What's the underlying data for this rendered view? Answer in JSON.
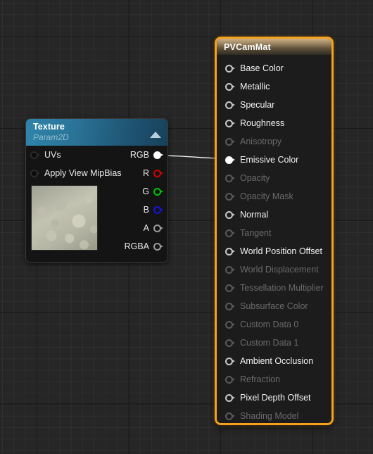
{
  "editor": {
    "name": "material-graph-editor",
    "background_color": "#262626",
    "grid_line_color": "#2f2f2f"
  },
  "texture_node": {
    "title": "Texture",
    "subtitle": "Param2D",
    "collapse_icon": "triangle-up-icon",
    "header_color": "#2a7397",
    "thumbnail_name": "texture-thumbnail",
    "inputs": [
      {
        "label": "UVs",
        "pin_style": "dark",
        "connected": false
      },
      {
        "label": "Apply View MipBias",
        "pin_style": "dark",
        "connected": false
      }
    ],
    "outputs": [
      {
        "label": "RGB",
        "pin_style": "filled",
        "color": "#ffffff",
        "connected": true
      },
      {
        "label": "R",
        "pin_style": "red",
        "color": "#d10000",
        "connected": false
      },
      {
        "label": "G",
        "pin_style": "green",
        "color": "#00c400",
        "connected": false
      },
      {
        "label": "B",
        "pin_style": "blue",
        "color": "#1414e0",
        "connected": false
      },
      {
        "label": "A",
        "pin_style": "gray",
        "color": "#9a9a9a",
        "connected": false
      },
      {
        "label": "RGBA",
        "pin_style": "gray",
        "color": "#9a9a9a",
        "connected": false
      }
    ]
  },
  "material_node": {
    "title": "PVCamMat",
    "selected": true,
    "selection_color": "#f5a01e",
    "header_color": "#9e8763",
    "inputs": [
      {
        "label": "Base Color",
        "enabled": true,
        "connected": false
      },
      {
        "label": "Metallic",
        "enabled": true,
        "connected": false
      },
      {
        "label": "Specular",
        "enabled": true,
        "connected": false
      },
      {
        "label": "Roughness",
        "enabled": true,
        "connected": false
      },
      {
        "label": "Anisotropy",
        "enabled": false,
        "connected": false
      },
      {
        "label": "Emissive Color",
        "enabled": true,
        "connected": true
      },
      {
        "label": "Opacity",
        "enabled": false,
        "connected": false
      },
      {
        "label": "Opacity Mask",
        "enabled": false,
        "connected": false
      },
      {
        "label": "Normal",
        "enabled": true,
        "connected": false
      },
      {
        "label": "Tangent",
        "enabled": false,
        "connected": false
      },
      {
        "label": "World Position Offset",
        "enabled": true,
        "connected": false
      },
      {
        "label": "World Displacement",
        "enabled": false,
        "connected": false
      },
      {
        "label": "Tessellation Multiplier",
        "enabled": false,
        "connected": false
      },
      {
        "label": "Subsurface Color",
        "enabled": false,
        "connected": false
      },
      {
        "label": "Custom Data 0",
        "enabled": false,
        "connected": false
      },
      {
        "label": "Custom Data 1",
        "enabled": false,
        "connected": false
      },
      {
        "label": "Ambient Occlusion",
        "enabled": true,
        "connected": false
      },
      {
        "label": "Refraction",
        "enabled": false,
        "connected": false
      },
      {
        "label": "Pixel Depth Offset",
        "enabled": true,
        "connected": false
      },
      {
        "label": "Shading Model",
        "enabled": false,
        "connected": false
      }
    ]
  },
  "connections": [
    {
      "name": "rgb-to-emissive-color-wire",
      "from_node": "Texture",
      "from_pin": "RGB",
      "to_node": "PVCamMat",
      "to_pin": "Emissive Color",
      "color": "#ffffff"
    }
  ]
}
